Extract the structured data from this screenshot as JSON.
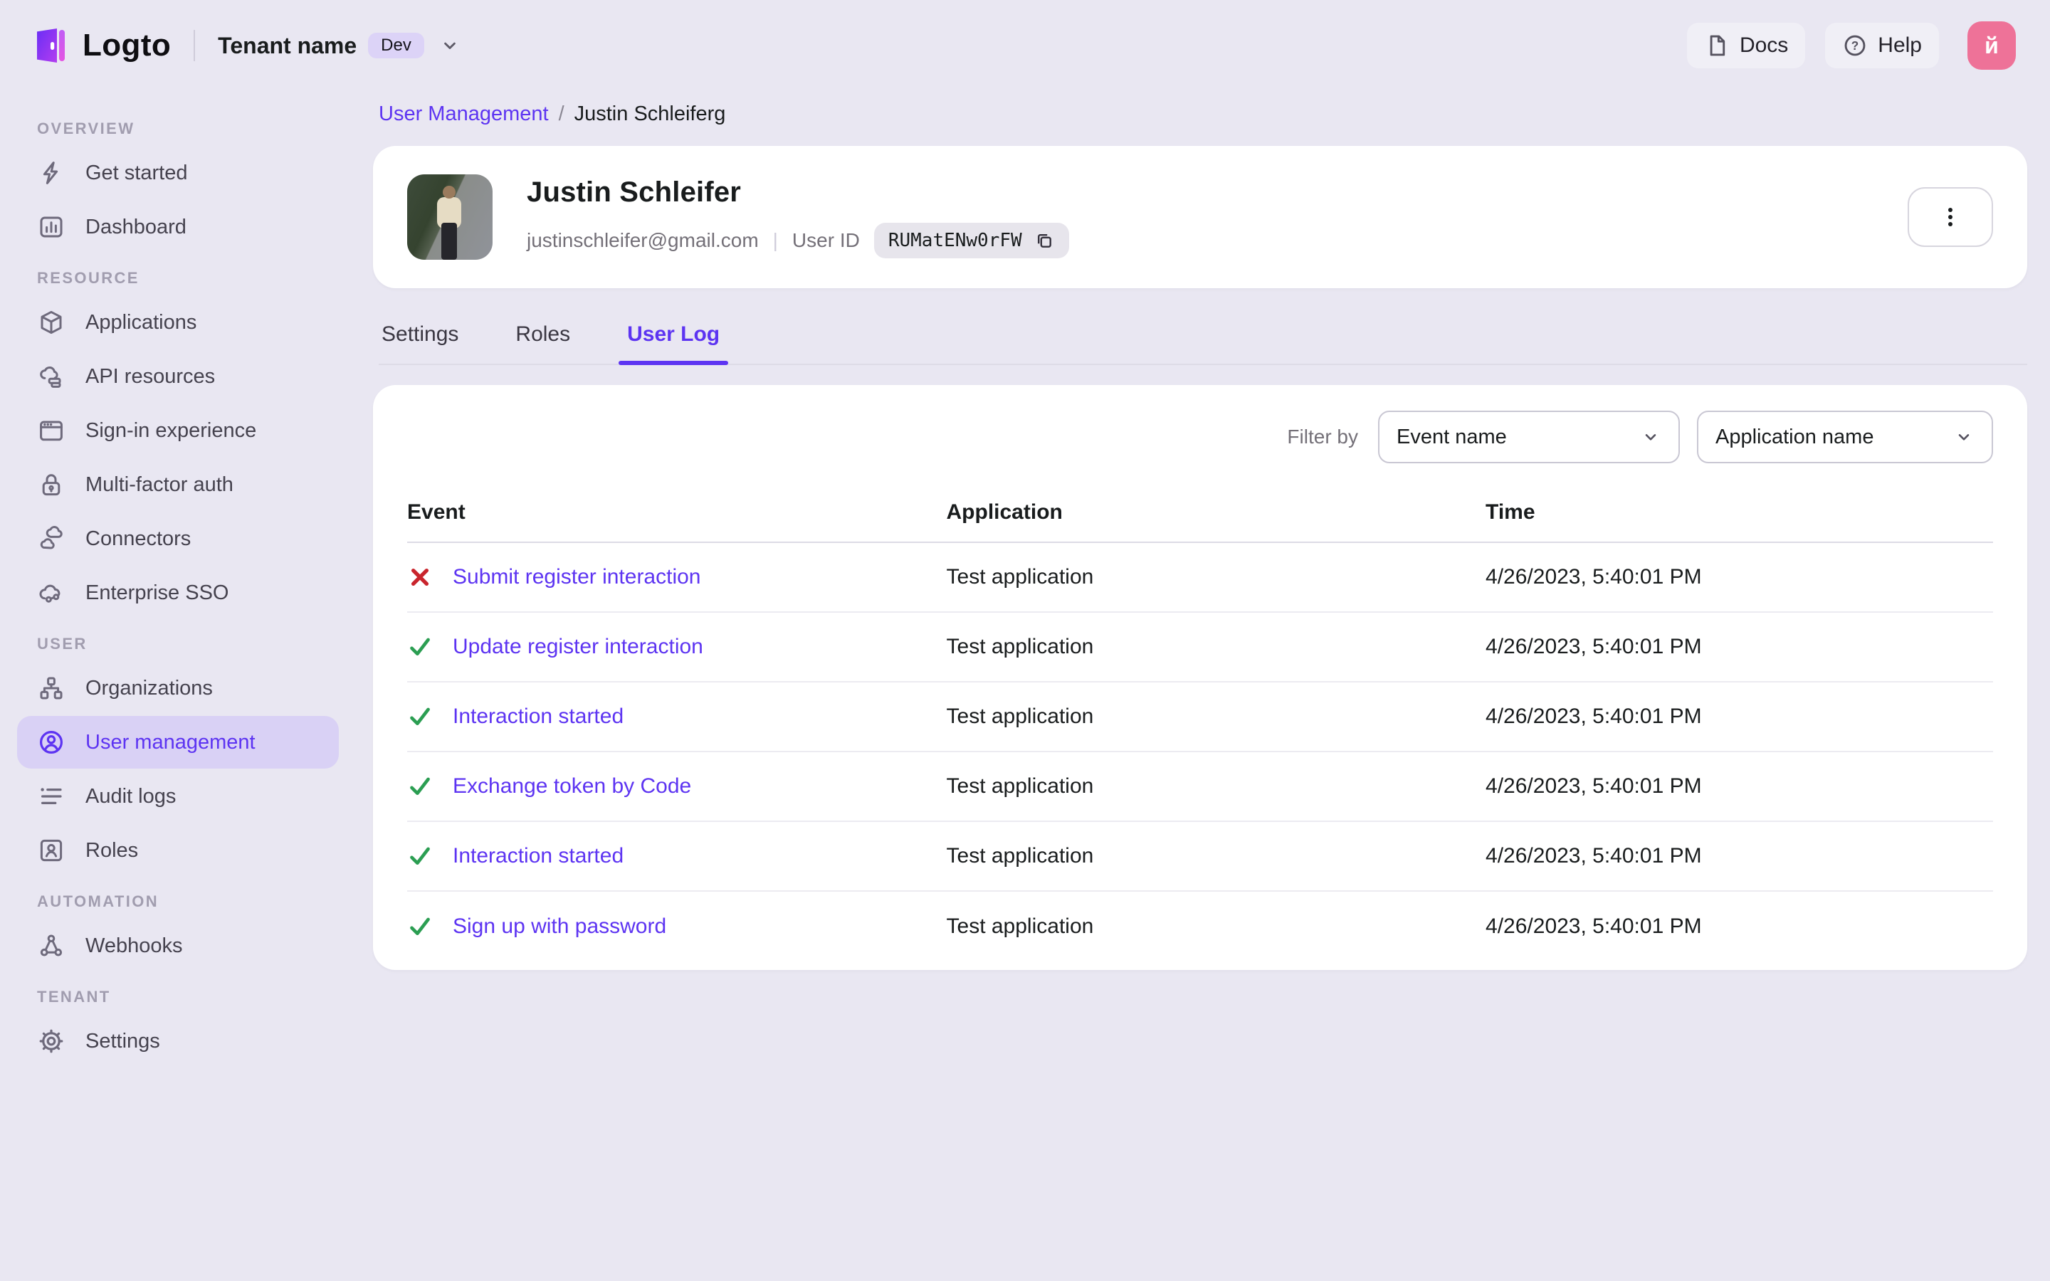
{
  "topbar": {
    "logo_text": "Logto",
    "tenant_name": "Tenant name",
    "tenant_badge": "Dev",
    "docs_label": "Docs",
    "help_label": "Help",
    "avatar_letter": "й"
  },
  "sidebar": {
    "sections": [
      {
        "label": "OVERVIEW",
        "items": [
          {
            "label": "Get started",
            "icon": "bolt-icon",
            "active": false
          },
          {
            "label": "Dashboard",
            "icon": "dashboard-icon",
            "active": false
          }
        ]
      },
      {
        "label": "RESOURCE",
        "items": [
          {
            "label": "Applications",
            "icon": "applications-cube-icon",
            "active": false
          },
          {
            "label": "API resources",
            "icon": "api-resources-icon",
            "active": false
          },
          {
            "label": "Sign-in experience",
            "icon": "sign-in-browser-icon",
            "active": false
          },
          {
            "label": "Multi-factor auth",
            "icon": "lock-icon",
            "active": false
          },
          {
            "label": "Connectors",
            "icon": "connectors-cloud-icon",
            "active": false
          },
          {
            "label": "Enterprise SSO",
            "icon": "enterprise-sso-icon",
            "active": false
          }
        ]
      },
      {
        "label": "USER",
        "items": [
          {
            "label": "Organizations",
            "icon": "org-tree-icon",
            "active": false
          },
          {
            "label": "User management",
            "icon": "user-circle-icon",
            "active": true
          },
          {
            "label": "Audit logs",
            "icon": "audit-list-icon",
            "active": false
          },
          {
            "label": "Roles",
            "icon": "role-card-icon",
            "active": false
          }
        ]
      },
      {
        "label": "AUTOMATION",
        "items": [
          {
            "label": "Webhooks",
            "icon": "webhook-icon",
            "active": false
          }
        ]
      },
      {
        "label": "TENANT",
        "items": [
          {
            "label": "Settings",
            "icon": "gear-icon",
            "active": false
          }
        ]
      }
    ]
  },
  "breadcrumb": {
    "parent": "User Management",
    "separator": "/",
    "current": "Justin Schleiferg"
  },
  "user_card": {
    "name": "Justin Schleifer",
    "email": "justinschleifer@gmail.com",
    "meta_divider": "|",
    "user_id_label": "User ID",
    "user_id": "RUMatENw0rFW"
  },
  "tabs": [
    {
      "label": "Settings",
      "active": false
    },
    {
      "label": "Roles",
      "active": false
    },
    {
      "label": "User Log",
      "active": true
    }
  ],
  "filter": {
    "label": "Filter by",
    "event_select_value": "Event name",
    "application_select_value": "Application name"
  },
  "log_table": {
    "headers": [
      "Event",
      "Application",
      "Time"
    ],
    "rows": [
      {
        "status": "fail",
        "event": "Submit register interaction",
        "application": "Test application",
        "time": "4/26/2023, 5:40:01 PM"
      },
      {
        "status": "success",
        "event": "Update register interaction",
        "application": "Test application",
        "time": "4/26/2023, 5:40:01 PM"
      },
      {
        "status": "success",
        "event": "Interaction started",
        "application": "Test application",
        "time": "4/26/2023, 5:40:01 PM"
      },
      {
        "status": "success",
        "event": "Exchange token by Code",
        "application": "Test application",
        "time": "4/26/2023, 5:40:01 PM"
      },
      {
        "status": "success",
        "event": "Interaction started",
        "application": "Test application",
        "time": "4/26/2023, 5:40:01 PM"
      },
      {
        "status": "success",
        "event": "Sign up with password",
        "application": "Test application",
        "time": "4/26/2023, 5:40:01 PM"
      }
    ]
  },
  "colors": {
    "accent": "#5d34f2",
    "success": "#2b9e52",
    "danger": "#c9252d",
    "avatar_pink": "#ee7298",
    "active_item_bg": "#d9d1f5",
    "background": "#e9e7f2"
  }
}
